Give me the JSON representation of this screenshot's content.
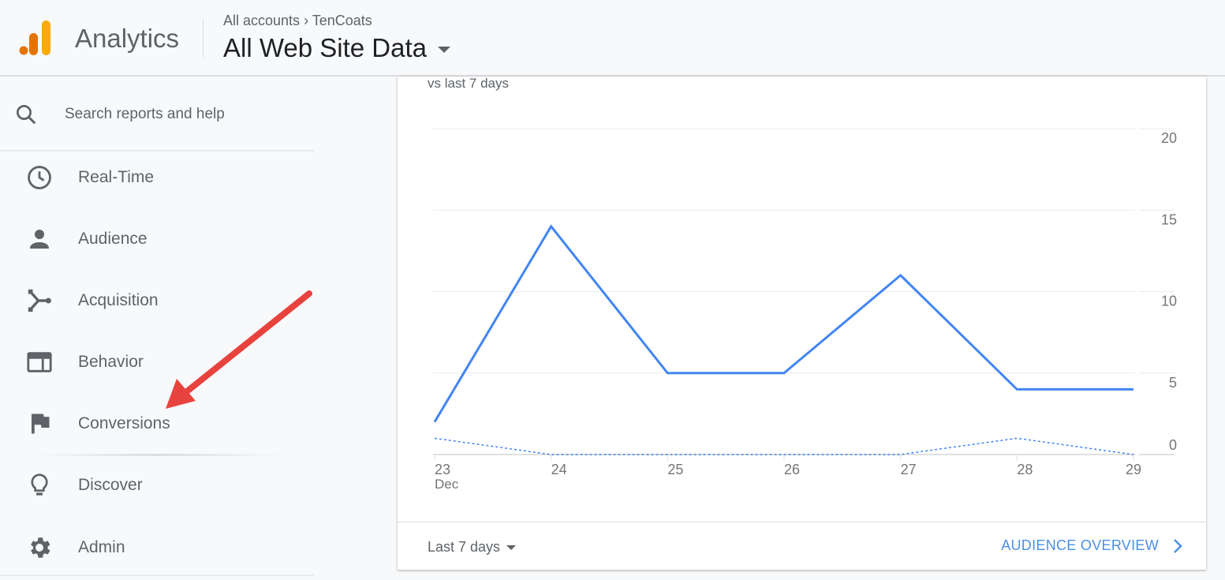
{
  "header": {
    "app_name": "Analytics",
    "breadcrumb": [
      "All accounts",
      "TenCoats"
    ],
    "view": "All Web Site Data"
  },
  "sidebar": {
    "search_placeholder": "Search reports and help",
    "items": [
      {
        "label": "Real-Time",
        "icon": "clock-icon"
      },
      {
        "label": "Audience",
        "icon": "person-icon"
      },
      {
        "label": "Acquisition",
        "icon": "acquisition-icon"
      },
      {
        "label": "Behavior",
        "icon": "behavior-icon"
      },
      {
        "label": "Conversions",
        "icon": "flag-icon"
      },
      {
        "label": "Discover",
        "icon": "lightbulb-icon"
      },
      {
        "label": "Admin",
        "icon": "gear-icon"
      }
    ]
  },
  "card": {
    "comparison": "vs last 7 days",
    "date_range": "Last 7 days",
    "link": "AUDIENCE OVERVIEW"
  },
  "colors": {
    "line": "#4285f4",
    "arrow": "#e8423f",
    "logo_dark": "#e37400",
    "logo_light": "#f9ab00"
  },
  "chart_data": {
    "type": "line",
    "categories": [
      "23",
      "24",
      "25",
      "26",
      "27",
      "28",
      "29"
    ],
    "x_sublabel": "Dec",
    "yticks": [
      "0",
      "5",
      "10",
      "15",
      "20"
    ],
    "ylim": [
      0,
      20
    ],
    "grid": true,
    "series": [
      {
        "style": "solid",
        "values": [
          2,
          14,
          5,
          5,
          11,
          4,
          4
        ]
      },
      {
        "style": "dashed",
        "values": [
          1,
          0,
          0,
          0,
          0,
          1,
          0
        ]
      }
    ]
  }
}
